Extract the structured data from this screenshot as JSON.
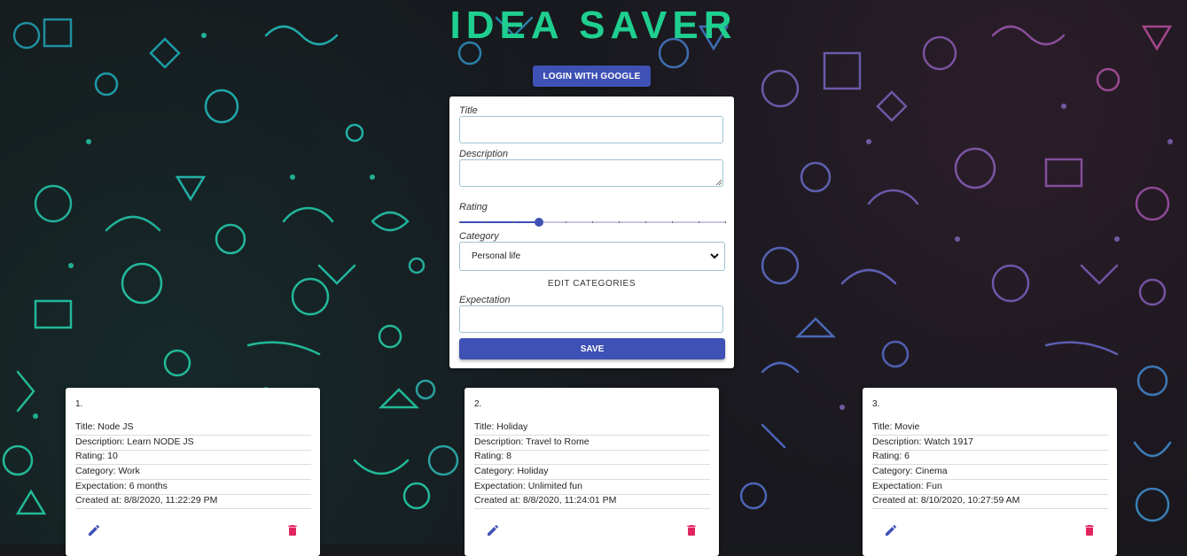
{
  "app": {
    "title": "IDEA SAVER"
  },
  "header": {
    "login_label": "LOGIN WITH GOOGLE"
  },
  "colors": {
    "accent": "#3f51b5",
    "title": "#1fcf8f",
    "delete": "#e0245e",
    "background": "#18191d"
  },
  "form": {
    "title_label": "Title",
    "title_value": "",
    "description_label": "Description",
    "description_value": "",
    "rating_label": "Rating",
    "rating_value": 3,
    "rating_max": 10,
    "category_label": "Category",
    "category_selected": "Personal life",
    "edit_categories_label": "EDIT CATEGORIES",
    "expectation_label": "Expectation",
    "expectation_value": "",
    "save_label": "SAVE"
  },
  "ideas": [
    {
      "number": "1.",
      "title": "Title: Node JS",
      "description": "Description: Learn NODE JS",
      "rating": "Rating: 10",
      "category": "Category: Work",
      "expectation": "Expectation: 6 months",
      "created": "Created at: 8/8/2020, 11:22:29 PM"
    },
    {
      "number": "2.",
      "title": "Title: Holiday",
      "description": "Description: Travel to Rome",
      "rating": "Rating: 8",
      "category": "Category: Holiday",
      "expectation": "Expectation: Unlimited fun",
      "created": "Created at: 8/8/2020, 11:24:01 PM"
    },
    {
      "number": "3.",
      "title": "Title: Movie",
      "description": "Description: Watch 1917",
      "rating": "Rating: 6",
      "category": "Category: Cinema",
      "expectation": "Expectation: Fun",
      "created": "Created at: 8/10/2020, 10:27:59 AM"
    }
  ],
  "icons": {
    "edit": "pencil-icon",
    "delete": "trash-icon",
    "dropdown": "chevron-down-icon"
  }
}
